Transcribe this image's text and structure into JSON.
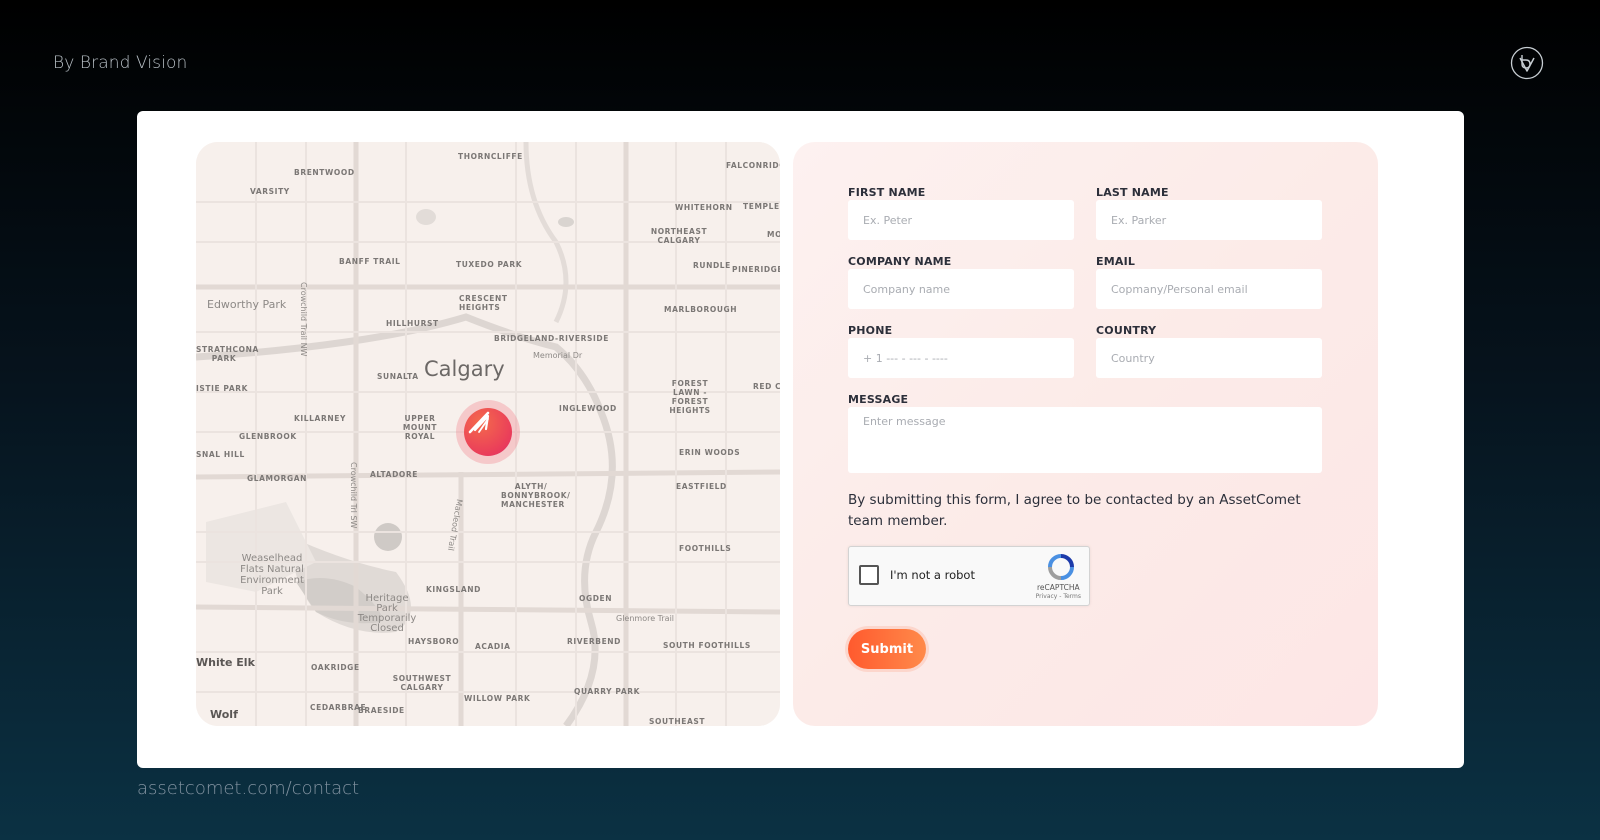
{
  "header": {
    "brand_text": "By Brand Vision",
    "logo_icon": "brand-vision-logo-icon"
  },
  "footer": {
    "url": "assetcomet.com/contact"
  },
  "map": {
    "city": "Calgary",
    "marker_icon": "assetcomet-logo-icon",
    "labels": [
      "THORNCLIFFE",
      "FALCONRIDGE",
      "BRENTWOOD",
      "VARSITY",
      "WHITEHORN",
      "TEMPLE",
      "NORTHEAST CALGARY",
      "MON",
      "BANFF TRAIL",
      "TUXEDO PARK",
      "RUNDLE",
      "PINERIDGE",
      "Edworthy Park",
      "CRESCENT HEIGHTS",
      "MARLBOROUGH",
      "HILLHURST",
      "BRIDGELAND-RIVERSIDE",
      "STRATHCONA PARK",
      "SUNALTA",
      "Memorial Dr",
      "FOREST LAWN - FOREST HEIGHTS",
      "RED CA",
      "ISTIE PARK",
      "KILLARNEY",
      "UPPER MOUNT ROYAL",
      "INGLEWOOD",
      "GLENBROOK",
      "SNAL HILL",
      "ERIN WOODS",
      "GLAMORGAN",
      "ALTADORE",
      "ALYTH/ BONNYBROOK/ MANCHESTER",
      "EASTFIELD",
      "Crowchild Trail NW",
      "Crowchild Trl SW",
      "Macleod Trail",
      "FOOTHILLS",
      "Weaselhead Flats Natural Environment Park",
      "KINGSLAND",
      "Heritage Park Temporarily Closed",
      "OGDEN",
      "Glenmore Trail",
      "HAYSBORO",
      "ACADIA",
      "RIVERBEND",
      "SOUTH FOOTHILLS",
      "White Elk",
      "OAKRIDGE",
      "SOUTHWEST CALGARY",
      "WILLOW PARK",
      "QUARRY PARK",
      "CEDARBRAE",
      "BRAESIDE",
      "SOUTHEAST",
      "Wolf"
    ]
  },
  "form": {
    "first_name": {
      "label": "FIRST NAME",
      "placeholder": "Ex. Peter",
      "value": ""
    },
    "last_name": {
      "label": "LAST NAME",
      "placeholder": "Ex. Parker",
      "value": ""
    },
    "company": {
      "label": "COMPANY NAME",
      "placeholder": "Company name",
      "value": ""
    },
    "email": {
      "label": "EMAIL",
      "placeholder": "Copmany/Personal email",
      "value": ""
    },
    "phone": {
      "label": "PHONE",
      "placeholder": "+ 1 --- - --- - ----",
      "value": ""
    },
    "country": {
      "label": "COUNTRY",
      "placeholder": "Country",
      "value": ""
    },
    "message": {
      "label": "MESSAGE",
      "placeholder": "Enter message",
      "value": ""
    },
    "consent_text": "By submitting this form, I agree to be contacted by an AssetComet team member.",
    "captcha": {
      "label": "I'm not a robot",
      "brand": "reCAPTCHA",
      "links": "Privacy - Terms",
      "checked": false
    },
    "submit_label": "Submit"
  },
  "colors": {
    "background_top": "#000000",
    "background_bottom": "#0b3143",
    "card": "#ffffff",
    "form_panel": "#fcebe8",
    "accent": "#ff6a3a",
    "marker": "#ea3d5a"
  }
}
